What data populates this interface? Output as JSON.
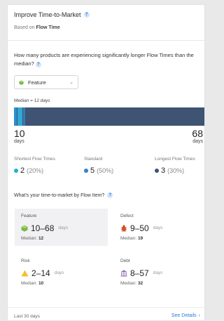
{
  "header": {
    "title": "Improve Time-to-Market",
    "subtitle_prefix": "Based on",
    "subtitle_strong": "Flow Time"
  },
  "question": "How many products are experiencing significantly longer Flow Times than the median?",
  "dropdown": {
    "selected": "Feature"
  },
  "distribution": {
    "median_label": "Median = 12 days",
    "min_value": "10",
    "min_unit": "days",
    "max_value": "68",
    "max_unit": "days"
  },
  "stats": {
    "shortest": {
      "label": "Shortest Flow Times",
      "count": "2",
      "percent": "(20%)",
      "color": "#20b2c7"
    },
    "standard": {
      "label": "Standard",
      "count": "5",
      "percent": "(50%)",
      "color": "#2f83c8"
    },
    "longest": {
      "label": "Longest Flow Times",
      "count": "3",
      "percent": "(30%)",
      "color": "#3f5372"
    }
  },
  "question2": "What's your time-to-market by Flow Item?",
  "tiles": {
    "feature": {
      "name": "Feature",
      "range": "10–68",
      "unit": "days",
      "median_label": "Median:",
      "median": "12"
    },
    "defect": {
      "name": "Defect",
      "range": "9–50",
      "unit": "days",
      "median_label": "Median:",
      "median": "19"
    },
    "risk": {
      "name": "Risk",
      "range": "2–14",
      "unit": "days",
      "median_label": "Median:",
      "median": "10"
    },
    "debt": {
      "name": "Debt",
      "range": "8–57",
      "unit": "days",
      "median_label": "Median:",
      "median": "32"
    }
  },
  "footer": {
    "period": "Last 30 days",
    "link": "See Details"
  },
  "icons": {
    "help": "help-icon",
    "feature": "feature-icon",
    "defect": "defect-icon",
    "risk": "risk-icon",
    "debt": "debt-icon"
  }
}
